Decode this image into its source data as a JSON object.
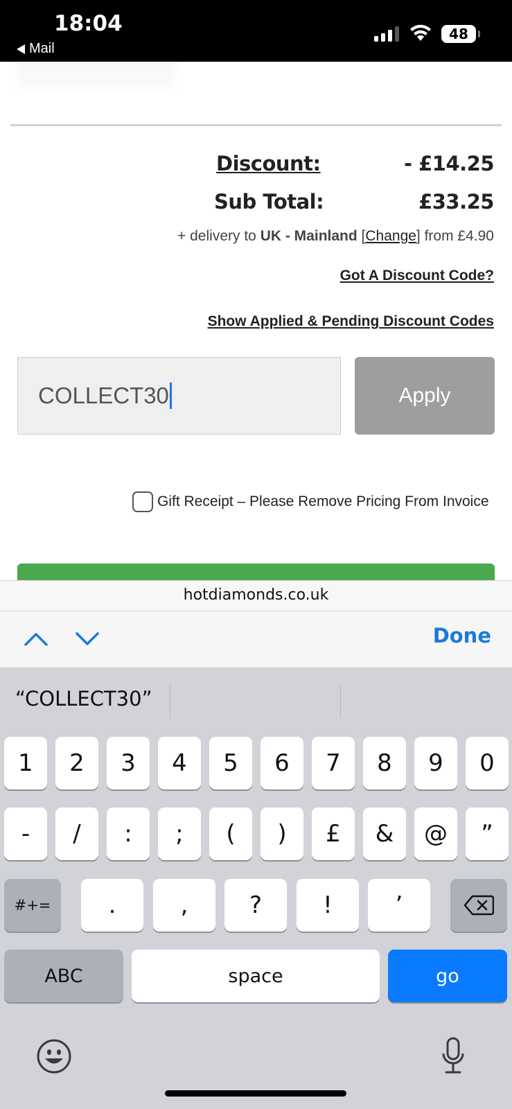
{
  "status_bar": {
    "time": "18:04",
    "back_label": "Mail",
    "battery": "48",
    "icons": [
      "signal-icon",
      "wifi-icon",
      "battery-icon"
    ]
  },
  "cart": {
    "discount_label": "Discount:",
    "discount_value": "- £14.25",
    "subtotal_label": "Sub Total:",
    "subtotal_value": "£33.25",
    "delivery_prefix": "+ delivery to ",
    "delivery_region": "UK - Mainland",
    "delivery_change_open": " [",
    "delivery_change": "Change",
    "delivery_change_close": "]",
    "delivery_from": " from £4.90",
    "discount_code_link": "Got A Discount Code?",
    "show_codes_link": "Show Applied & Pending Discount Codes",
    "code_value": "COLLECT30",
    "apply_label": "Apply",
    "gift_receipt_label": "Gift Receipt – Please Remove Pricing From Invoice",
    "gift_receipt_checked": false
  },
  "browser": {
    "url": "hotdiamonds.co.uk"
  },
  "accessory": {
    "done_label": "Done",
    "icons": [
      "chevron-up-icon",
      "chevron-down-icon"
    ]
  },
  "keyboard": {
    "suggestion": "“COLLECT30”",
    "row1": [
      "1",
      "2",
      "3",
      "4",
      "5",
      "6",
      "7",
      "8",
      "9",
      "0"
    ],
    "row2": [
      "-",
      "/",
      ":",
      ";",
      "(",
      ")",
      "£",
      "&",
      "@",
      "”"
    ],
    "row3_mode": "#+=",
    "row3": [
      ".",
      ",",
      "?",
      "!",
      "’"
    ],
    "abc_label": "ABC",
    "space_label": "space",
    "go_label": "go",
    "icons": [
      "delete-icon",
      "emoji-icon",
      "microphone-icon"
    ],
    "accent_color": "#0a7aff"
  }
}
